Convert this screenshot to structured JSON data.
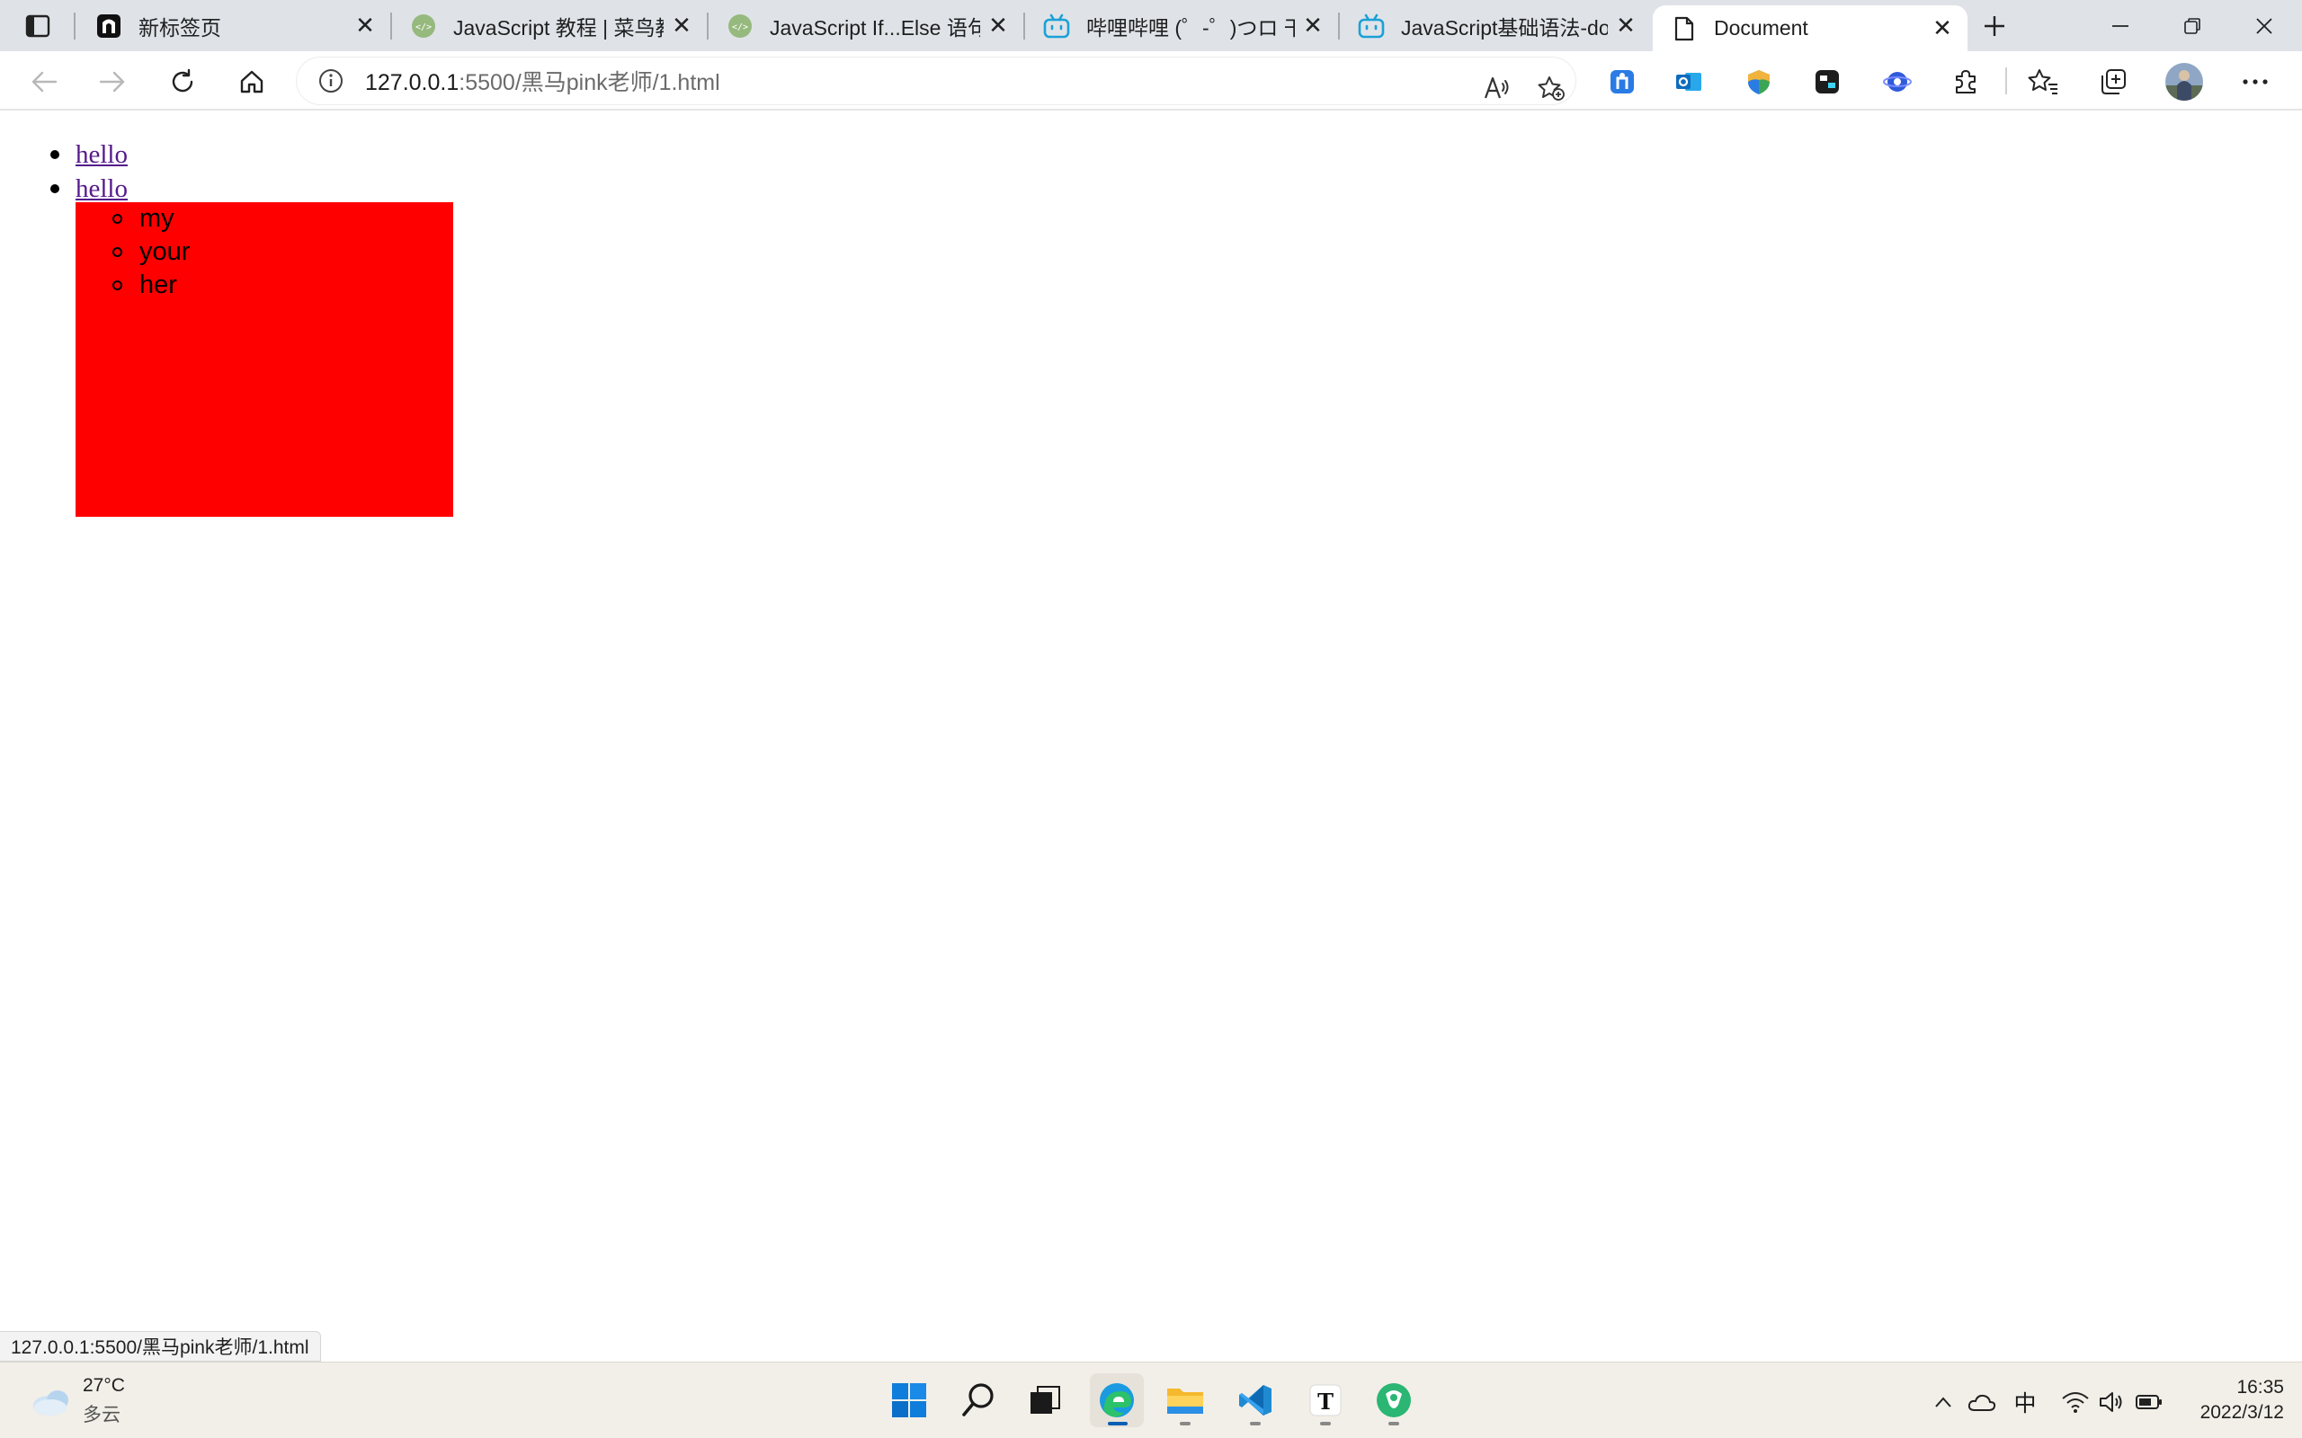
{
  "tabs": [
    {
      "title": "新标签页",
      "icon": "page-icon-black"
    },
    {
      "title": "JavaScript 教程 | 菜鸟教程",
      "icon": "runoob-icon"
    },
    {
      "title": "JavaScript If...Else 语句 | 菜",
      "icon": "runoob-icon"
    },
    {
      "title": "哔哩哔哩 (゜-゜)つロ 干杯",
      "icon": "bilibili-icon"
    },
    {
      "title": "JavaScript基础语法-dom-",
      "icon": "bilibili-icon"
    },
    {
      "title": "Document",
      "icon": "document-icon",
      "active": true
    }
  ],
  "address": {
    "host": "127.0.0.1",
    "rest": ":5500/黑马pink老师/1.html"
  },
  "page": {
    "items": [
      {
        "label": "hello"
      },
      {
        "label": "hello"
      }
    ],
    "submenu": [
      "my",
      "your",
      "her"
    ],
    "submenu_color": "#ff0000",
    "link_color": "#551a8b"
  },
  "status_url": "127.0.0.1:5500/黑马pink老师/1.html",
  "taskbar": {
    "weather_temp": "27°C",
    "weather_cond": "多云",
    "ime": "中",
    "time": "16:35",
    "date": "2022/3/12"
  },
  "colors": {
    "accent": "#0a5fb4",
    "tabstrip": "#dfe3e8"
  }
}
